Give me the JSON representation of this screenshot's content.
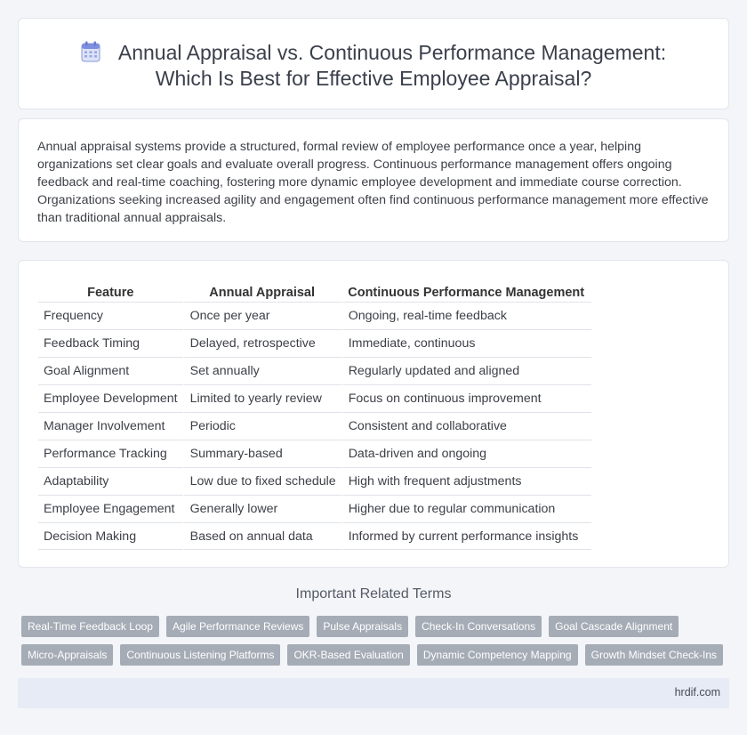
{
  "header": {
    "icon": "calendar-icon",
    "title_line1": "Annual Appraisal vs. Continuous Performance Management:",
    "title_line2": "Which Is Best for Effective Employee Appraisal?"
  },
  "intro": {
    "text": "Annual appraisal systems provide a structured, formal review of employee performance once a year, helping organizations set clear goals and evaluate overall progress. Continuous performance management offers ongoing feedback and real-time coaching, fostering more dynamic employee development and immediate course correction. Organizations seeking increased agility and engagement often find continuous performance management more effective than traditional annual appraisals."
  },
  "table": {
    "headers": [
      "Feature",
      "Annual Appraisal",
      "Continuous Performance Management"
    ],
    "rows": [
      [
        "Frequency",
        "Once per year",
        "Ongoing, real-time feedback"
      ],
      [
        "Feedback Timing",
        "Delayed, retrospective",
        "Immediate, continuous"
      ],
      [
        "Goal Alignment",
        "Set annually",
        "Regularly updated and aligned"
      ],
      [
        "Employee Development",
        "Limited to yearly review",
        "Focus on continuous improvement"
      ],
      [
        "Manager Involvement",
        "Periodic",
        "Consistent and collaborative"
      ],
      [
        "Performance Tracking",
        "Summary-based",
        "Data-driven and ongoing"
      ],
      [
        "Adaptability",
        "Low due to fixed schedule",
        "High with frequent adjustments"
      ],
      [
        "Employee Engagement",
        "Generally lower",
        "Higher due to regular communication"
      ],
      [
        "Decision Making",
        "Based on annual data",
        "Informed by current performance insights"
      ]
    ]
  },
  "related": {
    "title": "Important Related Terms",
    "row1": [
      "Real-Time Feedback Loop",
      "Agile Performance Reviews",
      "Pulse Appraisals",
      "Check-In Conversations",
      "Goal Cascade Alignment"
    ],
    "row2": [
      "Micro-Appraisals",
      "Continuous Listening Platforms",
      "OKR-Based Evaluation",
      "Dynamic Competency Mapping",
      "Growth Mindset Check-Ins"
    ]
  },
  "footer": {
    "site": "hrdif.com"
  },
  "colors": {
    "background": "#f3f5f9",
    "tag": "#a6acb6",
    "footer": "#e7ebf5"
  }
}
